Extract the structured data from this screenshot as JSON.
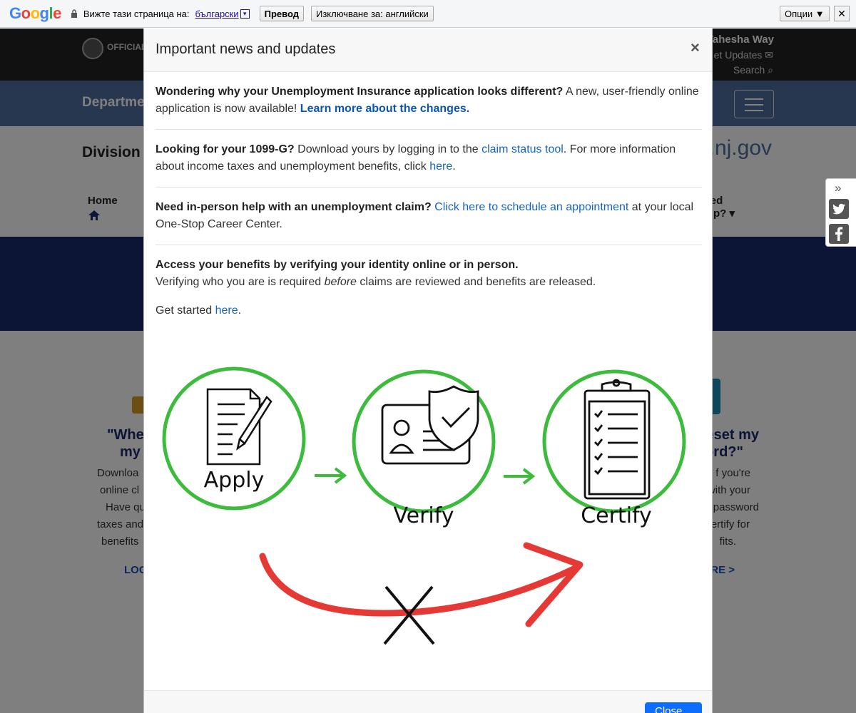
{
  "translate_bar": {
    "logo_letters": [
      "G",
      "o",
      "o",
      "g",
      "l",
      "e"
    ],
    "prompt": "Вижте тази страница на:",
    "language": "български",
    "dropdown": "▾",
    "translate_button": "Превод",
    "exclude_button": "Изключване за: английски",
    "options_button": "Опции ▼",
    "close_button": "✕"
  },
  "background_page": {
    "official": "OFFICIAL",
    "governor_name": "Tahesha Way",
    "get_updates": "et Updates ✉",
    "search": "Search ⌕",
    "department": "Departme",
    "division": "Division o",
    "domain": "z.nj.gov",
    "nav_home": "Home",
    "nav_need_1": "ed",
    "nav_need_2": "lp? ▾",
    "card_left": {
      "title_1": "\"Whe",
      "title_2": "my",
      "text": [
        "Downloa",
        "online cl",
        "Have qu",
        "taxes and",
        "benefits"
      ],
      "link": "LOG"
    },
    "card_right": {
      "title_1": "reset my",
      "title_2": "word?\"",
      "text": [
        "f you're",
        "with your",
        "password",
        "ertify for",
        "fits."
      ],
      "link": "RE >"
    }
  },
  "social": {
    "chevron": "»",
    "twitter_icon": "twitter-icon",
    "facebook_icon": "facebook-icon"
  },
  "modal": {
    "title": "Important news and updates",
    "close_x": "×",
    "s1_bold": "Wondering why your Unemployment Insurance application looks different?",
    "s1_text": " A new, user-friendly online application is now available! ",
    "s1_link": "Learn more about the changes.",
    "s2_bold": "Looking for your 1099-G?",
    "s2_text1": " Download yours by logging in to the ",
    "s2_link1": "claim status tool",
    "s2_text2": ". For more information about income taxes and unemployment benefits, click ",
    "s2_link2": "here",
    "s2_end": ".",
    "s3_bold": "Need in-person help with an unemployment claim?",
    "s3_link": " Click here to schedule an appointment",
    "s3_text": " at your local One-Stop Career Center.",
    "s4_bold": "Access your benefits by verifying your identity online or in person.",
    "s4_text1": "Verifying who you are is required ",
    "s4_em": "before",
    "s4_text2": " claims are reviewed and benefits are released.",
    "s4_start": "Get started ",
    "s4_link": "here",
    "s4_end": ".",
    "graphic": {
      "step1": "Apply",
      "step2": "Verify",
      "step3": "Certify",
      "circle_color": "#3dbb3d",
      "arrow_color": "#e53935"
    },
    "close_button": "Close"
  }
}
